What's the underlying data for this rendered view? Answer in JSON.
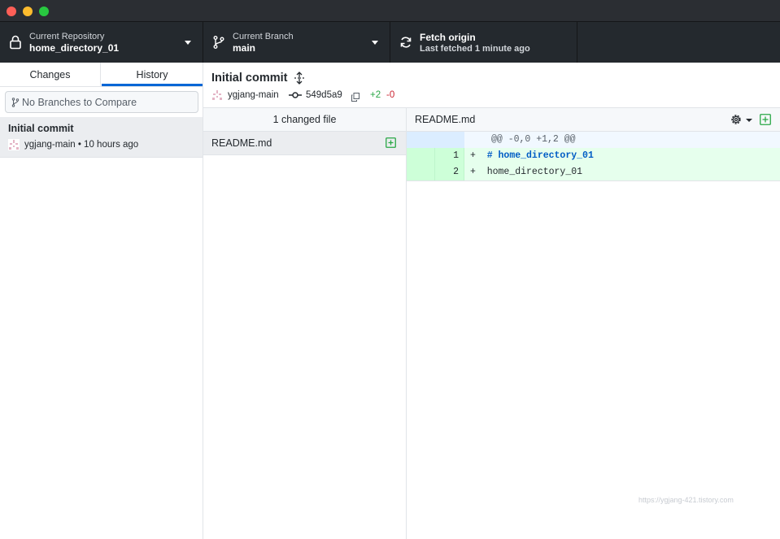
{
  "toolbar": {
    "repo": {
      "top": "Current Repository",
      "bottom": "home_directory_01"
    },
    "branch": {
      "top": "Current Branch",
      "bottom": "main"
    },
    "fetch": {
      "top": "Fetch origin",
      "bottom": "Last fetched 1 minute ago"
    }
  },
  "sidebar": {
    "tabs": [
      {
        "label": "Changes"
      },
      {
        "label": "History",
        "selected": true
      }
    ],
    "compare_placeholder": "No Branches to Compare",
    "commits": [
      {
        "title": "Initial commit",
        "meta": "ygjang-main • 10 hours ago"
      }
    ]
  },
  "commit": {
    "title": "Initial commit",
    "author": "ygjang-main",
    "sha": "549d5a9",
    "additions": "+2",
    "deletions": "-0"
  },
  "files": {
    "header": "1 changed file",
    "items": [
      {
        "name": "README.md",
        "status": "added"
      }
    ]
  },
  "diff": {
    "file": "README.md",
    "hunk": "@@ -0,0 +1,2 @@",
    "lines": [
      {
        "new_no": "1",
        "sign": "+",
        "text": "# home_directory_01"
      },
      {
        "new_no": "2",
        "sign": "+",
        "text": "home_directory_01"
      }
    ]
  },
  "watermark": "https://ygjang-421.tistory.com",
  "colors": {
    "accent": "#0366d6",
    "added": "#28a745",
    "deleted": "#cb2431",
    "toolbar": "#24292e"
  },
  "icons": [
    "lock-icon",
    "branch-icon",
    "sync-icon",
    "caret-down-icon",
    "git-branch-small-icon",
    "avatar-icon",
    "expand-icon",
    "git-commit-icon",
    "copy-icon",
    "file-added-icon",
    "gear-icon"
  ]
}
